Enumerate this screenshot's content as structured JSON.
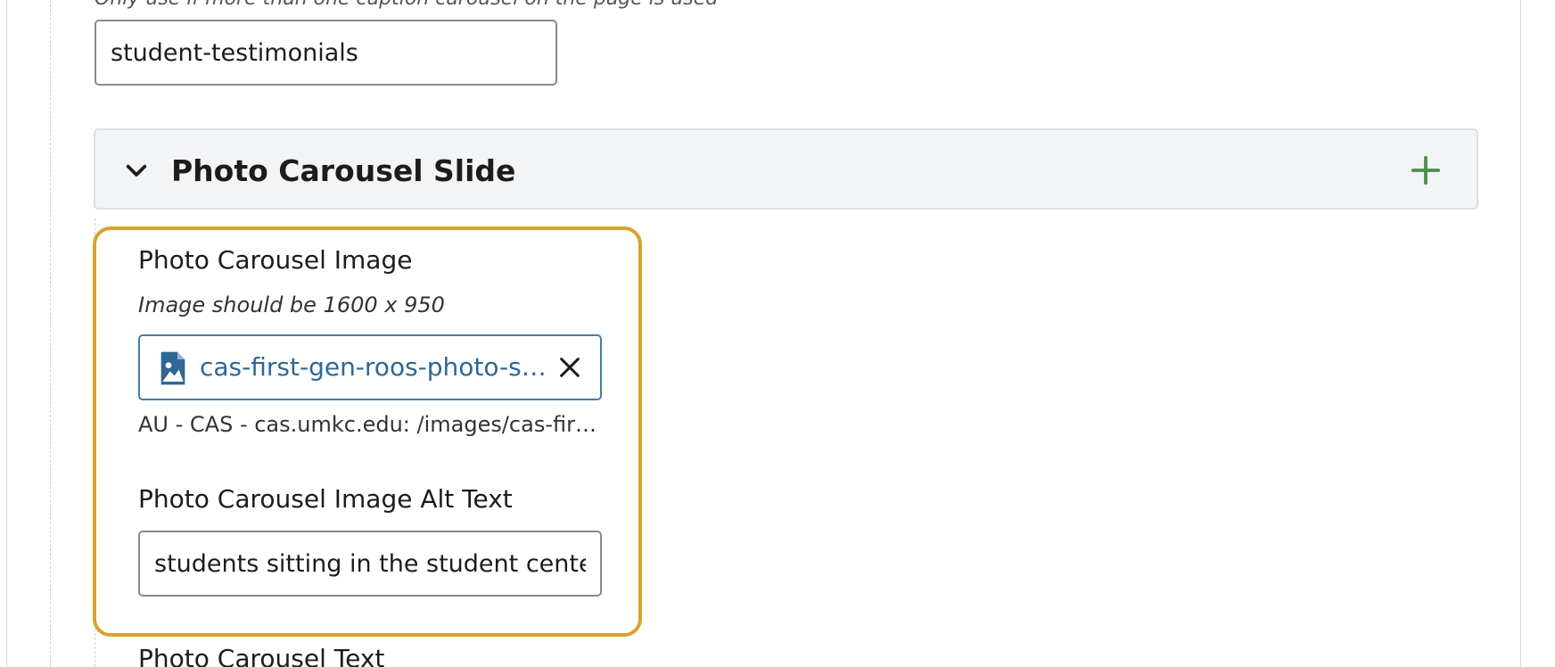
{
  "header_note": "Only use if more than one caption carousel on the page is used",
  "carousel_id": {
    "value": "student-testimonials"
  },
  "section": {
    "title": "Photo Carousel Slide",
    "collapse_icon": "chevron-down-icon",
    "add_icon": "plus-icon",
    "accent": "#4a8f4a"
  },
  "slide": {
    "image_label": "Photo Carousel Image",
    "image_hint": "Image should be 1600 x 950",
    "asset_name": "cas-first-gen-roos-photo-ses...",
    "asset_icon": "image-file-icon",
    "clear_icon": "close-icon",
    "asset_path": "AU - CAS - cas.umkc.edu: /images/cas-first-g...",
    "alt_label": "Photo Carousel Image Alt Text",
    "alt_value": "students sitting in the student center,",
    "highlight_color": "#d9a22c"
  },
  "next_label": "Photo Carousel Text"
}
